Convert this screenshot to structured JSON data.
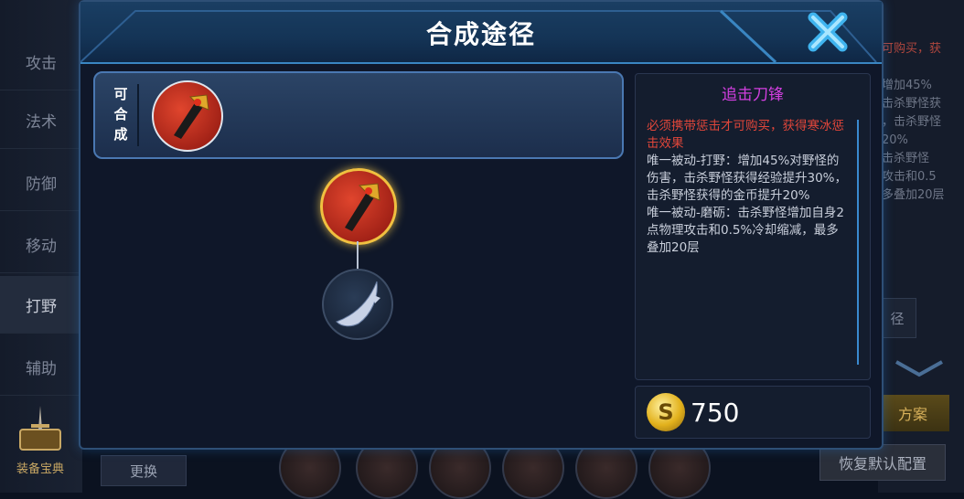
{
  "side_menu": {
    "items": [
      {
        "label": "攻击"
      },
      {
        "label": "法术"
      },
      {
        "label": "防御"
      },
      {
        "label": "移动"
      },
      {
        "label": "打野"
      },
      {
        "label": "辅助"
      }
    ],
    "active_index": 4,
    "codex_label": "装备宝典"
  },
  "background": {
    "swap_button": "更换",
    "restore_button": "恢复默认配置",
    "gold_button": "方案",
    "path_button": "径",
    "text_lines_red": "可购买，获",
    "text_lines": [
      "增加45%",
      "击杀野怪获",
      "，击杀野怪",
      "20%",
      "击杀野怪",
      "攻击和0.5",
      "多叠加20层"
    ]
  },
  "dialog": {
    "title": "合成途径",
    "close_icon": "close-x-icon",
    "tab_label": "可合成",
    "item": {
      "name": "追击刀锋",
      "requirement": "必须携带惩击才可购买，获得寒冰惩击效果",
      "desc_1": "唯一被动-打野：增加45%对野怪的伤害，击杀野怪获得经验提升30%，击杀野怪获得的金币提升20%",
      "desc_2": "唯一被动-磨砺：击杀野怪增加自身2点物理攻击和0.5%冷却缩减，最多叠加20层",
      "price": "750",
      "coin_symbol": "S"
    }
  },
  "colors": {
    "accent_blue": "#3a86c2",
    "item_name": "#d23fe0",
    "requirement": "#e0463a",
    "gold_ring": "#f0c040"
  }
}
